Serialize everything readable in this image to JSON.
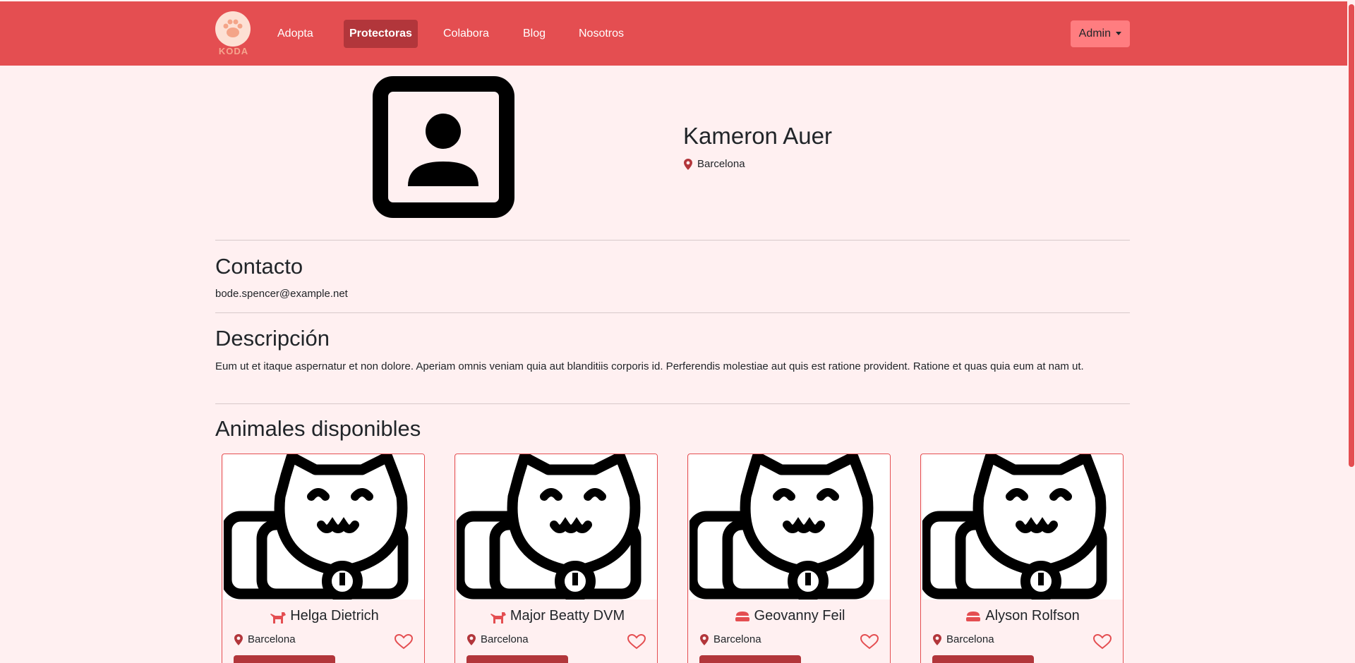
{
  "navbar": {
    "logo_text": "KODA",
    "links": [
      {
        "label": "Adopta"
      },
      {
        "label": "Protectoras",
        "active": true
      },
      {
        "label": "Colabora"
      },
      {
        "label": "Blog"
      },
      {
        "label": "Nosotros"
      }
    ],
    "admin_label": "Admin",
    "bg_color": "#e44e51",
    "active_color": "#b2363b"
  },
  "profile": {
    "name": "Kameron Auer",
    "location": "Barcelona",
    "photo_icon": "person-placeholder-icon"
  },
  "contact": {
    "title": "Contacto",
    "email": "bode.spencer@example.net"
  },
  "description": {
    "title": "Descripción",
    "text": "Eum ut et itaque aspernatur et non dolore. Aperiam omnis veniam quia aut blanditiis corporis id. Perferendis molestiae aut quis est ratione provident. Ratione et quas quia eum at nam ut."
  },
  "animals": {
    "title": "Animales disponibles",
    "items": [
      {
        "name": "Helga Dietrich",
        "type_icon": "dog-icon",
        "location": "Barcelona"
      },
      {
        "name": "Major Beatty DVM",
        "type_icon": "dog-icon",
        "location": "Barcelona"
      },
      {
        "name": "Geovanny Feil",
        "type_icon": "pet-bed-icon",
        "location": "Barcelona"
      },
      {
        "name": "Alyson Rolfson",
        "type_icon": "pet-bed-icon",
        "location": "Barcelona"
      }
    ]
  },
  "colors": {
    "page_bg": "#fff0f1",
    "accent": "#e44e51",
    "pin": "#b2363b"
  }
}
